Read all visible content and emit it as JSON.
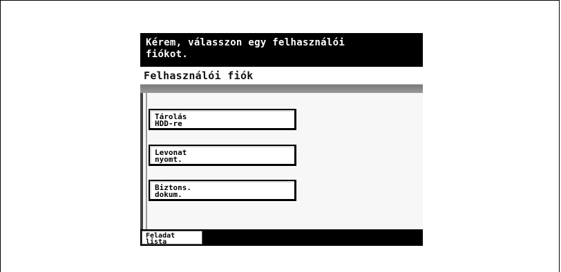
{
  "message": "Kérem, válasszon egy felhasználói\nfiókot.",
  "title": "Felhasználói fiók",
  "accounts": [
    {
      "label": "Tárolás\nHDD-re"
    },
    {
      "label": "Levonat\nnyomt."
    },
    {
      "label": "Biztons.\ndokum."
    }
  ],
  "footer": {
    "task_list_label": "Feladat\nlista"
  },
  "colors": {
    "bar": "#000000",
    "band": "#8a8a8a",
    "panel": "#f7f7f7"
  }
}
